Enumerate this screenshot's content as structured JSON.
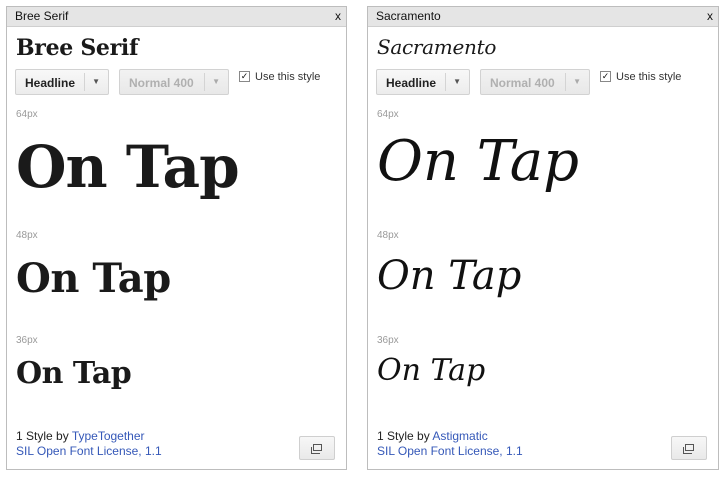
{
  "panels": [
    {
      "window_title": "Bree Serif",
      "close": "x",
      "font_name": "Bree Serif",
      "style_dropdown": "Headline",
      "weight_dropdown": "Normal 400",
      "use_style": {
        "label": "Use this style",
        "checked": true,
        "mark": "✓"
      },
      "samples": [
        {
          "size_label": "64px",
          "text": "On Tap"
        },
        {
          "size_label": "48px",
          "text": "On Tap"
        },
        {
          "size_label": "36px",
          "text": "On Tap"
        }
      ],
      "footer": {
        "styles_prefix": "1 Style by ",
        "designer": "TypeTogether",
        "license": "SIL Open Font License, 1.1"
      },
      "expand_icon": "expand-icon"
    },
    {
      "window_title": "Sacramento",
      "close": "x",
      "font_name": "Sacramento",
      "style_dropdown": "Headline",
      "weight_dropdown": "Normal 400",
      "use_style": {
        "label": "Use this style",
        "checked": true,
        "mark": "✓"
      },
      "samples": [
        {
          "size_label": "64px",
          "text": "On Tap"
        },
        {
          "size_label": "48px",
          "text": "On Tap"
        },
        {
          "size_label": "36px",
          "text": "On Tap"
        }
      ],
      "footer": {
        "styles_prefix": "1 Style by ",
        "designer": "Astigmatic",
        "license": "SIL Open Font License, 1.1"
      },
      "expand_icon": "expand-icon"
    }
  ],
  "arrow_glyph": "▼"
}
